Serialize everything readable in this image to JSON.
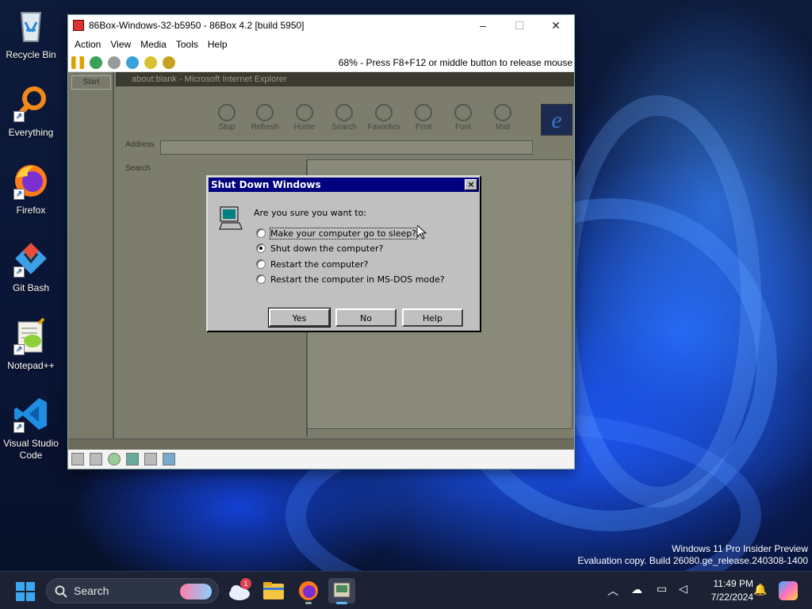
{
  "desktop": {
    "icons": [
      {
        "label": "Recycle Bin"
      },
      {
        "label": "Everything"
      },
      {
        "label": "Firefox"
      },
      {
        "label": "Git Bash"
      },
      {
        "label": "Notepad++"
      },
      {
        "label": "Visual Studio Code"
      }
    ],
    "watermark": {
      "line1": "Windows 11 Pro Insider Preview",
      "line2": "Evaluation copy. Build 26080.ge_release.240308-1400"
    }
  },
  "emulator": {
    "title": "86Box-Windows-32-b5950 - 86Box 4.2 [build 5950]",
    "menu": [
      "Action",
      "View",
      "Media",
      "Tools",
      "Help"
    ],
    "status": "68% - Press F8+F12 or middle button to release mouse"
  },
  "guest": {
    "start_label": "Start",
    "window_title": "about:blank - Microsoft Internet Explorer",
    "toolbar": [
      "Stop",
      "Refresh",
      "Home",
      "Search",
      "Favorites",
      "Print",
      "Font",
      "Mail"
    ],
    "address_label": "Address",
    "search_label": "Search"
  },
  "dialog": {
    "title": "Shut Down Windows",
    "prompt": "Are you sure you want to:",
    "options": [
      {
        "label": "Make your computer go to sleep?",
        "selected": false
      },
      {
        "label": "Shut down the computer?",
        "selected": true
      },
      {
        "label": "Restart the computer?",
        "selected": false
      },
      {
        "label": "Restart the computer in MS-DOS mode?",
        "selected": false
      }
    ],
    "buttons": {
      "yes": "Yes",
      "no": "No",
      "help": "Help"
    }
  },
  "taskbar": {
    "search_label": "Search",
    "weather_badge": "1",
    "clock_time": "11:49 PM",
    "clock_date": "7/22/2024"
  },
  "colors": {
    "dialog_title": "#000080",
    "dialog_face": "#c0c0c0",
    "taskbar": "#1c2233"
  }
}
